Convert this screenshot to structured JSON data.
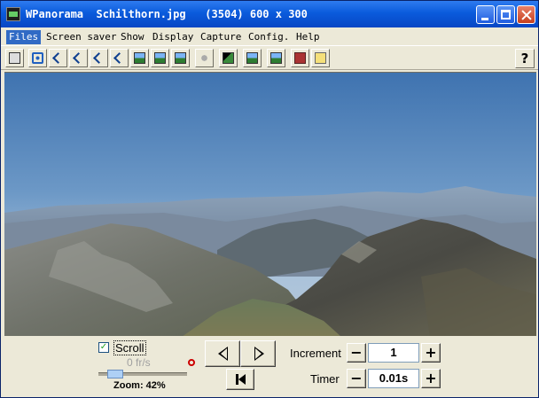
{
  "window": {
    "title": "WPanorama  Schilthorn.jpg   (3504) 600 x 300",
    "icon": "app-icon"
  },
  "menu": [
    "Files",
    "Screen saver",
    "Show",
    "Display",
    "Capture",
    "Config.",
    "Help"
  ],
  "toolbar": {
    "icons": [
      "print-icon",
      "move-icon",
      "arrow-nw-icon",
      "arrow-ne-icon",
      "arrow-sw-icon",
      "arrow-se-icon",
      "image-fit-icon",
      "image-wide-icon",
      "image-narrow-icon",
      "sound-icon",
      "mountain-icon",
      "panorama-icon",
      "gallery-icon",
      "book-icon",
      "help-book-icon"
    ],
    "help_label": "?"
  },
  "controls": {
    "scroll_checked": true,
    "scroll_check_mark": "✓",
    "scroll_label": "Scroll",
    "fps_label": "0 fr/s",
    "zoom_label": "Zoom: 42%",
    "zoom_percent": 42,
    "increment_label": "Increment",
    "increment_value": "1",
    "timer_label": "Timer",
    "timer_value": "0.01s",
    "minus": "−",
    "plus": "+"
  },
  "colors": {
    "titlebar": "#0A5BDC",
    "face": "#ECE9D8",
    "menu_highlight": "#316AC5"
  }
}
